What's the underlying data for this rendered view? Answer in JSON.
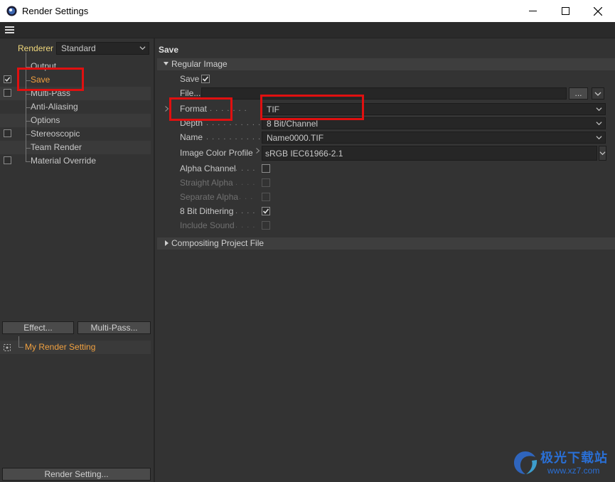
{
  "window": {
    "title": "Render Settings"
  },
  "left_panel": {
    "renderer_label": "Renderer",
    "renderer_value": "Standard",
    "tree": [
      {
        "label": "Output",
        "checkbox": false,
        "checked": false,
        "alt": false
      },
      {
        "label": "Save",
        "checkbox": true,
        "checked": true,
        "alt": false,
        "active": true
      },
      {
        "label": "Multi-Pass",
        "checkbox": true,
        "checked": false,
        "alt": true
      },
      {
        "label": "Anti-Aliasing",
        "checkbox": false,
        "checked": false,
        "alt": false
      },
      {
        "label": "Options",
        "checkbox": false,
        "checked": false,
        "alt": true
      },
      {
        "label": "Stereoscopic",
        "checkbox": true,
        "checked": false,
        "alt": false
      },
      {
        "label": "Team Render",
        "checkbox": false,
        "checked": false,
        "alt": true
      },
      {
        "label": "Material Override",
        "checkbox": true,
        "checked": false,
        "alt": false
      }
    ],
    "effect_button": "Effect...",
    "multipass_button": "Multi-Pass...",
    "render_setting_item": "My Render Setting",
    "render_setting_button": "Render Setting..."
  },
  "right_panel": {
    "section_title": "Save",
    "group_regular": "Regular Image",
    "save_label": "Save",
    "file_label": "File...",
    "file_value": "",
    "file_browse": "...",
    "format_label": "Format",
    "format_value": "TIF",
    "depth_label": "Depth",
    "depth_value": "8 Bit/Channel",
    "name_label": "Name",
    "name_value": "Name0000.TIF",
    "profile_label": "Image Color Profile",
    "profile_value": "sRGB IEC61966-2.1",
    "alpha_channel": "Alpha Channel",
    "straight_alpha": "Straight Alpha",
    "separate_alpha": "Separate Alpha",
    "dithering": "8 Bit Dithering",
    "include_sound": "Include Sound",
    "group_compositing": "Compositing Project File"
  },
  "watermark": {
    "text": "极光下载站",
    "url": "www.xz7.com"
  },
  "colors": {
    "active": "#f0a040",
    "renderer_label": "#f0d87c",
    "highlight": "#e01010"
  }
}
